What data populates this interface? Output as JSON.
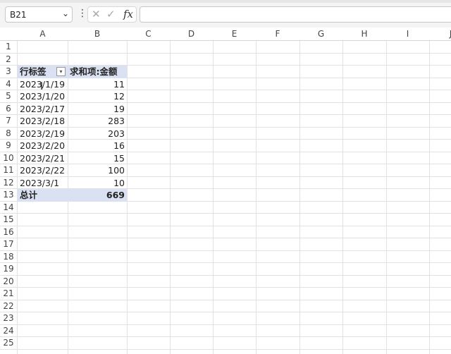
{
  "formula_bar": {
    "name_box": "B21",
    "name_box_chevron": "⌄",
    "more": "⋮",
    "cancel": "✕",
    "enter": "✓",
    "fx": "fx",
    "formula_value": ""
  },
  "columns": [
    "A",
    "B",
    "C",
    "D",
    "E",
    "F",
    "G",
    "H",
    "I",
    "J"
  ],
  "rows": [
    1,
    2,
    3,
    4,
    5,
    6,
    7,
    8,
    9,
    10,
    11,
    12,
    13,
    14,
    15,
    16,
    17,
    18,
    19,
    20,
    21,
    22,
    23,
    24,
    25
  ],
  "pivot": {
    "row_label_header": "行标签",
    "value_header": "求和项:金额",
    "filter_glyph": "▾",
    "items": [
      {
        "label": "2023/1/19",
        "value": "11"
      },
      {
        "label": "2023/1/20",
        "value": "12"
      },
      {
        "label": "2023/2/17",
        "value": "19"
      },
      {
        "label": "2023/2/18",
        "value": "283"
      },
      {
        "label": "2023/2/19",
        "value": "203"
      },
      {
        "label": "2023/2/20",
        "value": "16"
      },
      {
        "label": "2023/2/21",
        "value": "15"
      },
      {
        "label": "2023/2/22",
        "value": "100"
      },
      {
        "label": "2023/3/1",
        "value": "10"
      }
    ],
    "total_label": "总计",
    "total_value": "669"
  },
  "cursor_glyph": "I"
}
